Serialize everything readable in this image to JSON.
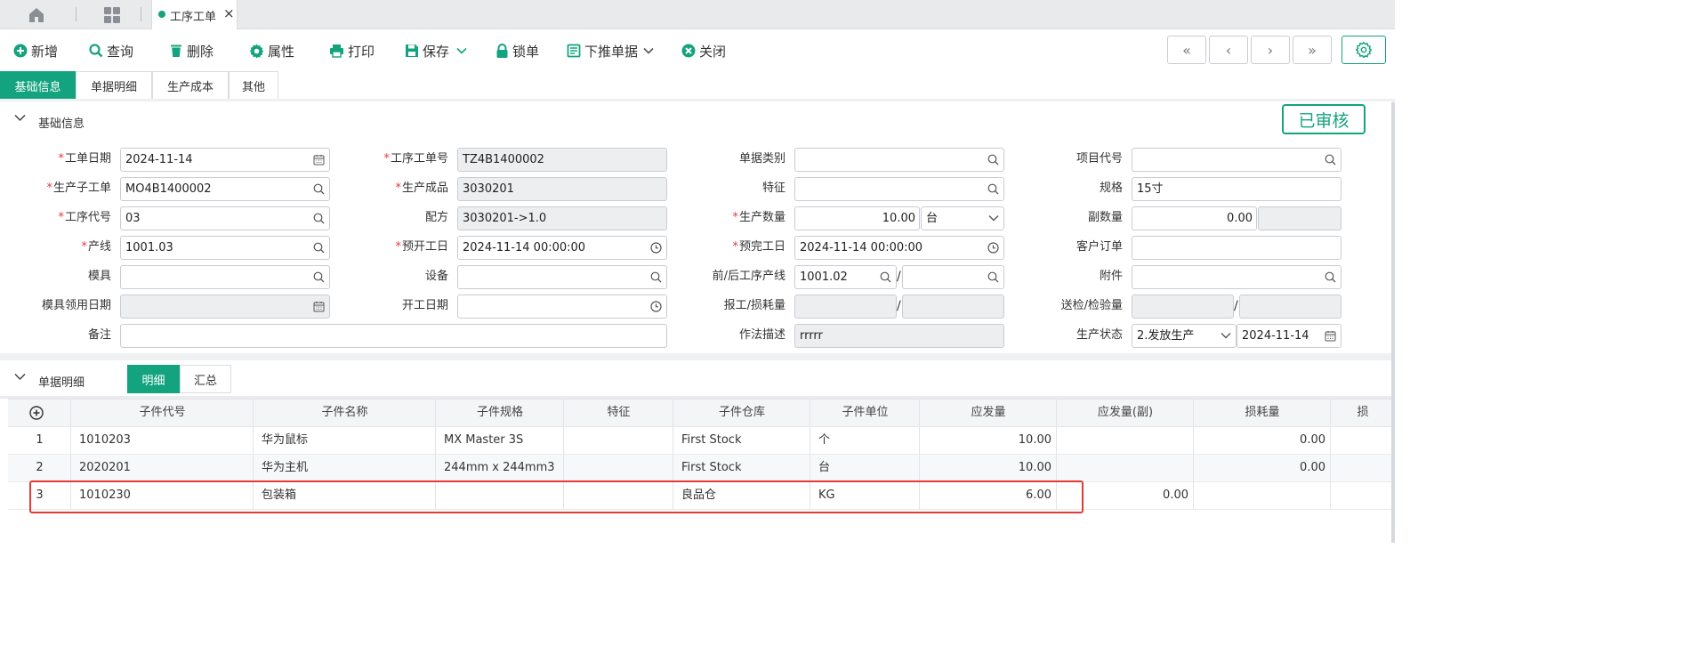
{
  "topbar": {
    "active_tab": "工序工单"
  },
  "toolbar": {
    "new": "新增",
    "query": "查询",
    "delete": "删除",
    "properties": "属性",
    "print": "打印",
    "save": "保存",
    "lock": "锁单",
    "push_down": "下推单据",
    "close": "关闭",
    "nav": [
      "«",
      "‹",
      "›",
      "»"
    ]
  },
  "tabs": [
    "基础信息",
    "单据明细",
    "生产成本",
    "其他"
  ],
  "basic": {
    "section_title": "基础信息",
    "status_stamp": "已审核",
    "labels": {
      "order_date": "工单日期",
      "op_order_no": "工序工单号",
      "doc_type": "单据类别",
      "project_code": "项目代号",
      "sub_order": "生产子工单",
      "product": "生产成品",
      "feature": "特征",
      "spec": "规格",
      "op_code": "工序代号",
      "formula": "配方",
      "qty": "生产数量",
      "sub_qty": "副数量",
      "line": "产线",
      "plan_start": "预开工日",
      "plan_end": "预完工日",
      "customer_order": "客户订单",
      "mold": "模具",
      "equipment": "设备",
      "prev_next_line": "前/后工序产线",
      "attachment": "附件",
      "mold_date": "模具领用日期",
      "start_date": "开工日期",
      "report_loss": "报工/损耗量",
      "inspect": "送检/检验量",
      "remark": "备注",
      "method": "作法描述",
      "prod_status": "生产状态"
    },
    "values": {
      "order_date": "2024-11-14",
      "op_order_no": "TZ4B1400002",
      "doc_type": "",
      "project_code": "",
      "sub_order": "MO4B1400002",
      "product": "3030201",
      "feature": "",
      "spec": "15寸",
      "op_code": "03",
      "formula": "3030201->1.0",
      "qty": "10.00",
      "qty_unit": "台",
      "sub_qty": "0.00",
      "sub_qty_unit": "",
      "line": "1001.03",
      "plan_start": "2024-11-14 00:00:00",
      "plan_end": "2024-11-14 00:00:00",
      "customer_order": "",
      "mold": "",
      "equipment": "",
      "prev_line": "1001.02",
      "next_line": "",
      "attachment": "",
      "mold_date": "",
      "start_date": "",
      "report_qty": "",
      "loss_qty": "",
      "inspect_qty": "",
      "checked_qty": "",
      "remark": "",
      "method": "rrrrr",
      "prod_status": "2.发放生产",
      "status_date": "2024-11-14"
    }
  },
  "detail": {
    "section_title": "单据明细",
    "subtabs": [
      "明细",
      "汇总"
    ],
    "columns": [
      "子件代号",
      "子件名称",
      "子件规格",
      "特征",
      "子件仓库",
      "子件单位",
      "应发量",
      "应发量(副)",
      "损耗量",
      "损"
    ],
    "rows": [
      {
        "no": "1",
        "code": "1010203",
        "name": "华为鼠标",
        "spec": "MX Master 3S",
        "feature": "",
        "warehouse": "First Stock",
        "unit": "个",
        "qty": "10.00",
        "qty_sub": "",
        "loss": "0.00"
      },
      {
        "no": "2",
        "code": "2020201",
        "name": "华为主机",
        "spec": "244mm x 244mm3",
        "feature": "",
        "warehouse": "First Stock",
        "unit": "台",
        "qty": "10.00",
        "qty_sub": "",
        "loss": "0.00"
      },
      {
        "no": "3",
        "code": "1010230",
        "name": "包装箱",
        "spec": "",
        "feature": "",
        "warehouse": "良品仓",
        "unit": "KG",
        "qty": "6.00",
        "qty_sub": "0.00",
        "loss": ""
      }
    ]
  },
  "colors": {
    "accent": "#14a37f",
    "required": "#e53935",
    "highlight": "#e53935"
  }
}
